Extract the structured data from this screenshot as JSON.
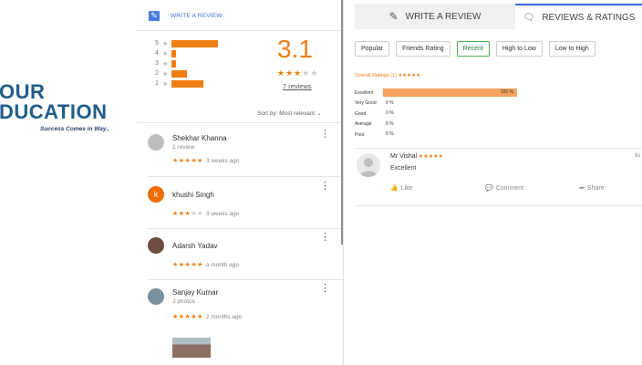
{
  "logo": {
    "line1": "OUR",
    "line2": "DUCATION",
    "tagline": "Success Comes in Way.."
  },
  "google": {
    "write_review": "WRITE A REVIEW",
    "histogram": [
      {
        "label": "5",
        "fraction": 0.75
      },
      {
        "label": "4",
        "fraction": 0.07
      },
      {
        "label": "3",
        "fraction": 0.07
      },
      {
        "label": "2",
        "fraction": 0.25
      },
      {
        "label": "1",
        "fraction": 0.52
      }
    ],
    "score": "3.1",
    "stars": 3,
    "reviews_link": "7 reviews",
    "sort_label": "Sort by:",
    "sort_value": "Most relevant",
    "reviews": [
      {
        "name": "Shekhar Khanna",
        "sub": "1 review",
        "stars": 5,
        "time": "3 weeks ago",
        "avatar_color": "#9e9e9e"
      },
      {
        "name": "khushi Singh",
        "sub": "",
        "stars": 3,
        "time": "3 weeks ago",
        "avatar_letter": "k",
        "avatar_color": "#ef6c00"
      },
      {
        "name": "Adarsh Yadav",
        "sub": "",
        "stars": 5,
        "time": "a month ago",
        "avatar_color": "#5d4037"
      },
      {
        "name": "Sanjay Kumar",
        "sub": "3 photos",
        "stars": 5,
        "time": "2 months ago",
        "avatar_color": "#607d8b"
      }
    ]
  },
  "justdial": {
    "tab_write": "WRITE A REVIEW",
    "tab_reviews": "REVIEWS & RATINGS",
    "filters": [
      "Popular",
      "Friends Rating",
      "Recent",
      "High to Low",
      "Low to High"
    ],
    "active_filter": "Recent",
    "overall": "Overall Ratings (1) ★★★★★",
    "breakdown": [
      {
        "label": "Excellent",
        "pct": "100 %",
        "value": 100
      },
      {
        "label": "Very Good",
        "pct": "0 %",
        "value": 0
      },
      {
        "label": "Good",
        "pct": "0 %",
        "value": 0
      },
      {
        "label": "Average",
        "pct": "0 %",
        "value": 0
      },
      {
        "label": "Poor",
        "pct": "0 %",
        "value": 0
      }
    ],
    "review": {
      "name": "Mr Vishal",
      "stars": "★★★★★",
      "text": "Excellent",
      "time": "8s"
    },
    "actions": {
      "like": "Like",
      "comment": "Comment",
      "share": "Share"
    }
  }
}
